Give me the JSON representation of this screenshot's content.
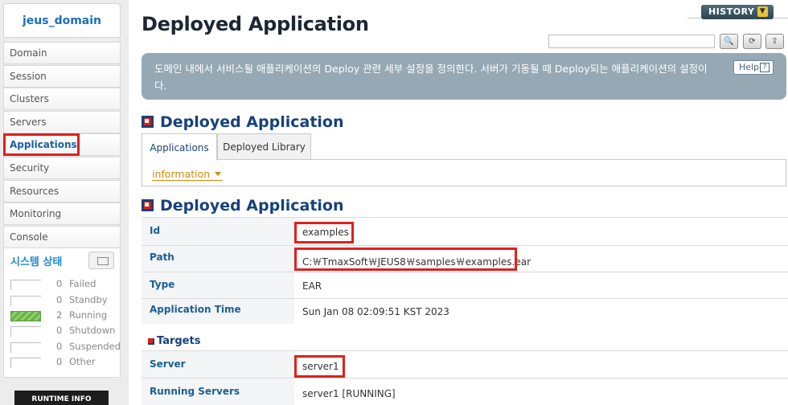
{
  "sidebar": {
    "domain": "jeus_domain",
    "items": [
      {
        "label": "Domain"
      },
      {
        "label": "Session"
      },
      {
        "label": "Clusters"
      },
      {
        "label": "Servers"
      },
      {
        "label": "Applications"
      },
      {
        "label": "Security"
      },
      {
        "label": "Resources"
      },
      {
        "label": "Monitoring"
      },
      {
        "label": "Console"
      }
    ],
    "active_item": "Applications",
    "status": {
      "title": "시스템 상태",
      "rows": [
        {
          "count": "0",
          "label": "Failed",
          "fill": 0
        },
        {
          "count": "0",
          "label": "Standby",
          "fill": 0
        },
        {
          "count": "2",
          "label": "Running",
          "fill": 1
        },
        {
          "count": "0",
          "label": "Shutdown",
          "fill": 0
        },
        {
          "count": "0",
          "label": "Suspended",
          "fill": 0
        },
        {
          "count": "0",
          "label": "Other",
          "fill": 0
        }
      ]
    },
    "runtime_label": "RUNTIME INFO"
  },
  "header": {
    "title": "Deployed Application",
    "history_label": "HISTORY",
    "search_value": "",
    "help_label": "Help",
    "description": "도메인 내에서 서비스될 애플리케이션의 Deploy 관련 세부 설정을 정의한다. 서버가 기동될 때 Deploy되는 애플리케이션의 설정이다."
  },
  "section1": {
    "title": "Deployed Application",
    "tabs": [
      {
        "label": "Applications",
        "active": true
      },
      {
        "label": "Deployed Library",
        "active": false
      }
    ],
    "dropdown_value": "information"
  },
  "section2": {
    "title": "Deployed Application",
    "fields": {
      "id_label": "Id",
      "id_value": "examples",
      "path_label": "Path",
      "path_value": "C:￦TmaxSoft￦JEUS8￦samples￦examples.ear",
      "type_label": "Type",
      "type_value": "EAR",
      "time_label": "Application Time",
      "time_value": "Sun Jan 08 02:09:51 KST 2023"
    },
    "targets_title": "Targets",
    "targets": {
      "server_label": "Server",
      "server_value": "server1",
      "running_label": "Running Servers",
      "running_value": "server1 [RUNNING]"
    }
  },
  "colors": {
    "accent": "#16417c",
    "highlight": "#e0201c",
    "running": "#6ab04c"
  }
}
